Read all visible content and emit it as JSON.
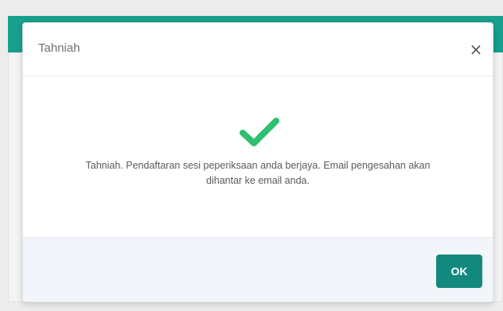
{
  "dialog": {
    "title": "Tahniah",
    "close_icon": "close-icon",
    "close_label": "×",
    "success_icon": "checkmark-icon",
    "message": "Tahniah. Pendaftaran sesi peperiksaan anda berjaya. Email pengesahan akan dihantar ke email anda.",
    "ok_label": "OK"
  },
  "colors": {
    "header_teal": "#17a08d",
    "ok_button": "#13897d",
    "success_green": "#2fbf71",
    "footer_bg": "#f2f5f9"
  }
}
